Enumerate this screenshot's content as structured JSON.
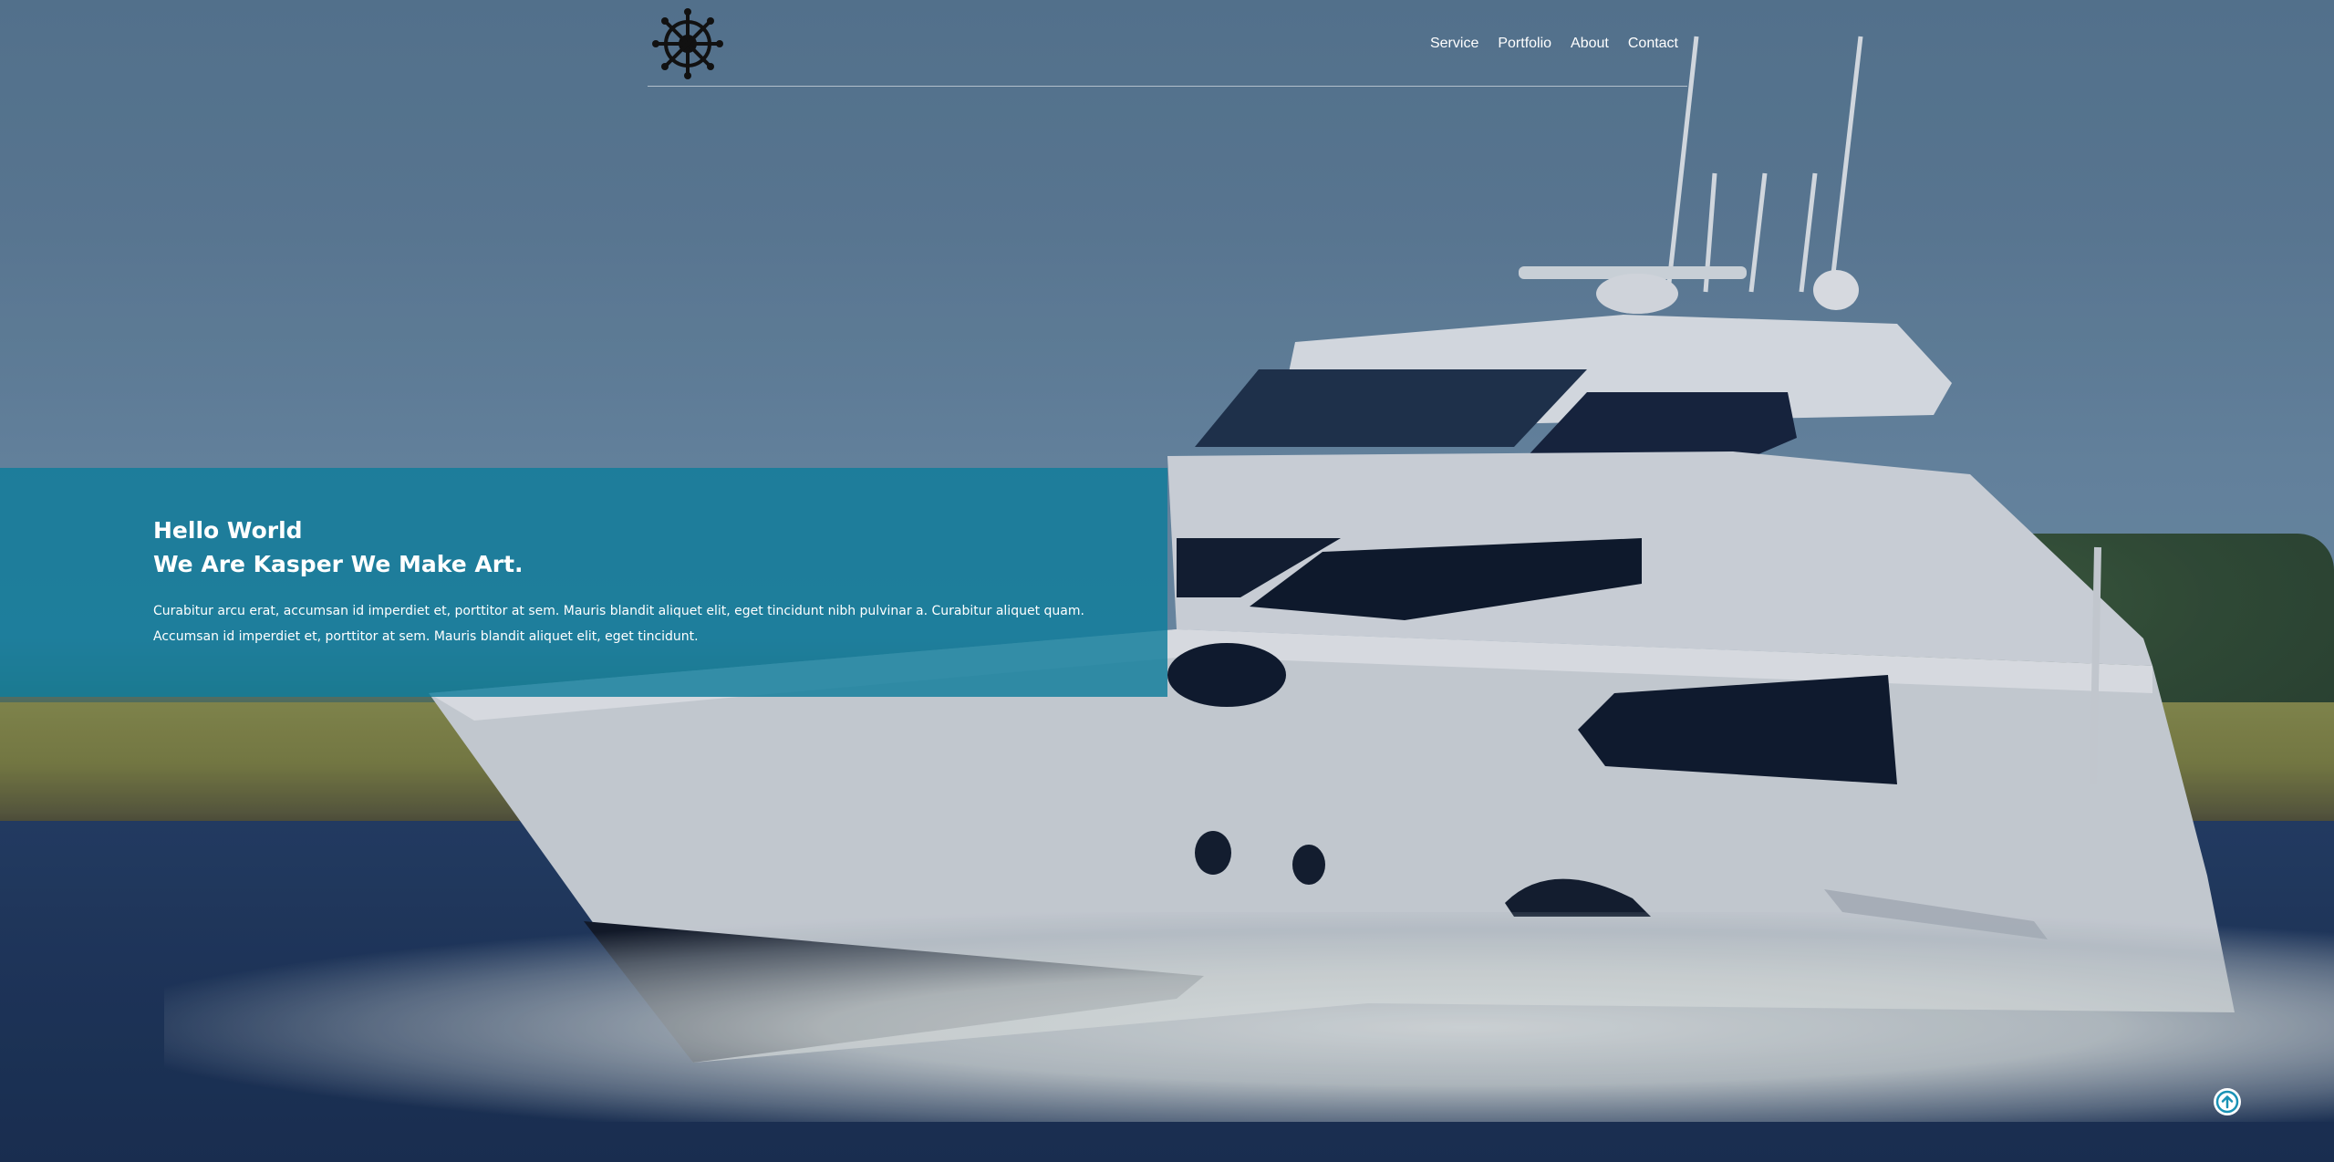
{
  "header": {
    "logo_icon": "ship-wheel-icon",
    "nav": [
      {
        "label": "Service"
      },
      {
        "label": "Portfolio"
      },
      {
        "label": "About"
      },
      {
        "label": "Contact"
      }
    ]
  },
  "intro": {
    "title_line1": "Hello World",
    "title_line2": "We Are Kasper We Make Art.",
    "paragraph": "Curabitur arcu erat, accumsan id imperdiet et, porttitor at sem. Mauris blandit aliquet elit, eget tincidunt nibh pulvinar a. Curabitur aliquet quam. Accumsan id imperdiet et, porttitor at sem. Mauris blandit aliquet elit, eget tincidunt."
  },
  "scroll_top": {
    "icon": "arrow-up-circle-icon"
  },
  "colors": {
    "intro_bg": "#0f7d9b",
    "scroll_top_icon": "#1a92b5"
  }
}
